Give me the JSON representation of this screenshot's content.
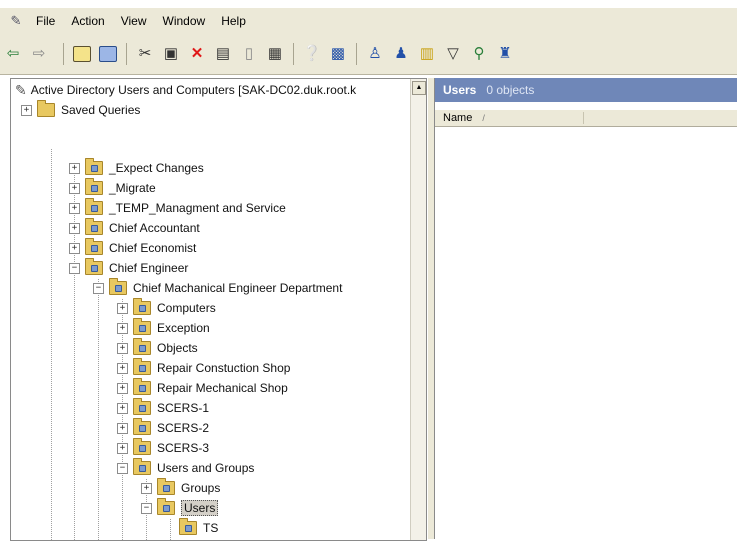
{
  "menu": {
    "items": [
      {
        "label": "File"
      },
      {
        "label": "Action"
      },
      {
        "label": "View"
      },
      {
        "label": "Window"
      },
      {
        "label": "Help"
      }
    ]
  },
  "toolbar": {
    "buttons": [
      "back-icon",
      "forward-icon",
      "up-folder-icon",
      "show-hide-tree-icon",
      "cut-icon",
      "copy-icon",
      "delete-icon",
      "properties-icon",
      "export-icon",
      "refresh-icon",
      "help-icon",
      "console-icon",
      "new-user-icon",
      "new-group-icon",
      "new-ou-icon",
      "filter-icon",
      "find-icon",
      "add-to-group-icon"
    ]
  },
  "tree": {
    "root": "Active Directory Users and Computers [SAK-DC02.duk.root.k",
    "saved_queries": "Saved Queries",
    "nodes": [
      {
        "label": "_Expect Changes",
        "expander": "+"
      },
      {
        "label": "_Migrate",
        "expander": "+"
      },
      {
        "label": "_TEMP_Managment and Service",
        "expander": "+"
      },
      {
        "label": "Chief Accountant",
        "expander": "+"
      },
      {
        "label": "Chief Economist",
        "expander": "+"
      },
      {
        "label": "Chief Engineer",
        "expander": "−"
      },
      {
        "label": "Chief Machanical Engineer Department",
        "expander": "−"
      },
      {
        "label": "Computers",
        "expander": "+"
      },
      {
        "label": "Exception",
        "expander": "+"
      },
      {
        "label": "Objects",
        "expander": "+"
      },
      {
        "label": "Repair Constuction Shop",
        "expander": "+"
      },
      {
        "label": "Repair Mechanical Shop",
        "expander": "+"
      },
      {
        "label": "SCERS-1",
        "expander": "+"
      },
      {
        "label": "SCERS-2",
        "expander": "+"
      },
      {
        "label": "SCERS-3",
        "expander": "+"
      },
      {
        "label": "Users and Groups",
        "expander": "−"
      },
      {
        "label": "Groups",
        "expander": "+"
      },
      {
        "label": "Users",
        "expander": "−"
      },
      {
        "label": "TS",
        "expander": ""
      }
    ]
  },
  "right_pane": {
    "title": "Users",
    "count": "0 objects",
    "column_name": "Name",
    "sort_indicator": "/"
  },
  "colors": {
    "chrome": "#ece9d8",
    "header_bar": "#6f87b8",
    "folder": "#e8c860"
  }
}
